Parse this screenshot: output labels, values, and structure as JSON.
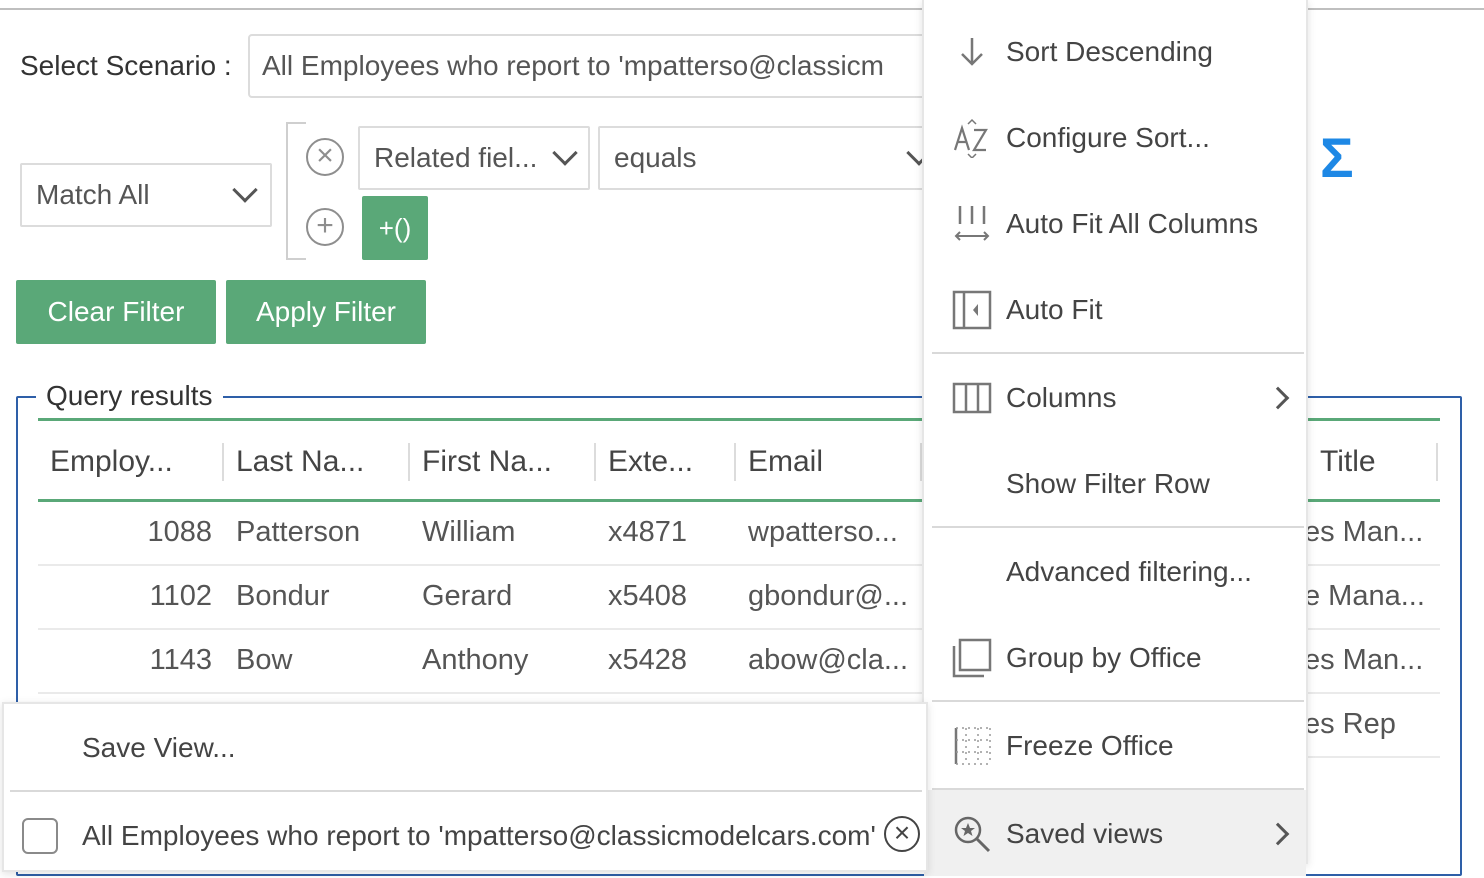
{
  "scenario": {
    "label": "Select Scenario :",
    "value": "All Employees who report to 'mpatterso@classicm"
  },
  "filter": {
    "match": "Match All",
    "field": "Related fiel...",
    "operator": "equals",
    "remove_icon": "x-circle-icon",
    "add_icon": "plus-circle-icon",
    "paren_button": "+()",
    "clear_button": "Clear Filter",
    "apply_button": "Apply Filter"
  },
  "results": {
    "legend": "Query results",
    "columns": [
      "Employ...",
      "Last Na...",
      "First Na...",
      "Exte...",
      "Email",
      "Title"
    ],
    "title_column_visible": "Title",
    "rows": [
      {
        "id": "1088",
        "last": "Patterson",
        "first": "William",
        "ext": "x4871",
        "email": "wpatterso...",
        "title": "es Man..."
      },
      {
        "id": "1102",
        "last": "Bondur",
        "first": "Gerard",
        "ext": "x5408",
        "email": "gbondur@...",
        "title": "e Mana..."
      },
      {
        "id": "1143",
        "last": "Bow",
        "first": "Anthony",
        "ext": "x5428",
        "email": "abow@cla...",
        "title": "es Man..."
      },
      {
        "title": "es Rep"
      }
    ]
  },
  "context_menu": {
    "items": [
      {
        "label": "Sort Descending",
        "icon": "arrow-down-icon"
      },
      {
        "label": "Configure Sort...",
        "icon": "sort-az-icon"
      },
      {
        "label": "Auto Fit All Columns",
        "icon": "autofit-columns-icon"
      },
      {
        "label": "Auto Fit",
        "icon": "autofit-icon"
      },
      {
        "label": "Columns",
        "icon": "columns-icon"
      },
      {
        "label": "Show Filter Row",
        "icon": ""
      },
      {
        "label": "Advanced filtering...",
        "icon": ""
      },
      {
        "label": "Group by Office",
        "icon": "group-icon"
      },
      {
        "label": "Freeze Office",
        "icon": "freeze-icon"
      },
      {
        "label": "Saved views",
        "icon": "saved-views-icon"
      }
    ]
  },
  "saved_views_menu": {
    "save_view": "Save View...",
    "view_name": "All Employees who report to 'mpatterso@classicmodelcars.com'"
  },
  "colors": {
    "accent_green": "#5aa878",
    "border_blue": "#2e5fa8",
    "sigma_blue": "#1e88e5"
  }
}
